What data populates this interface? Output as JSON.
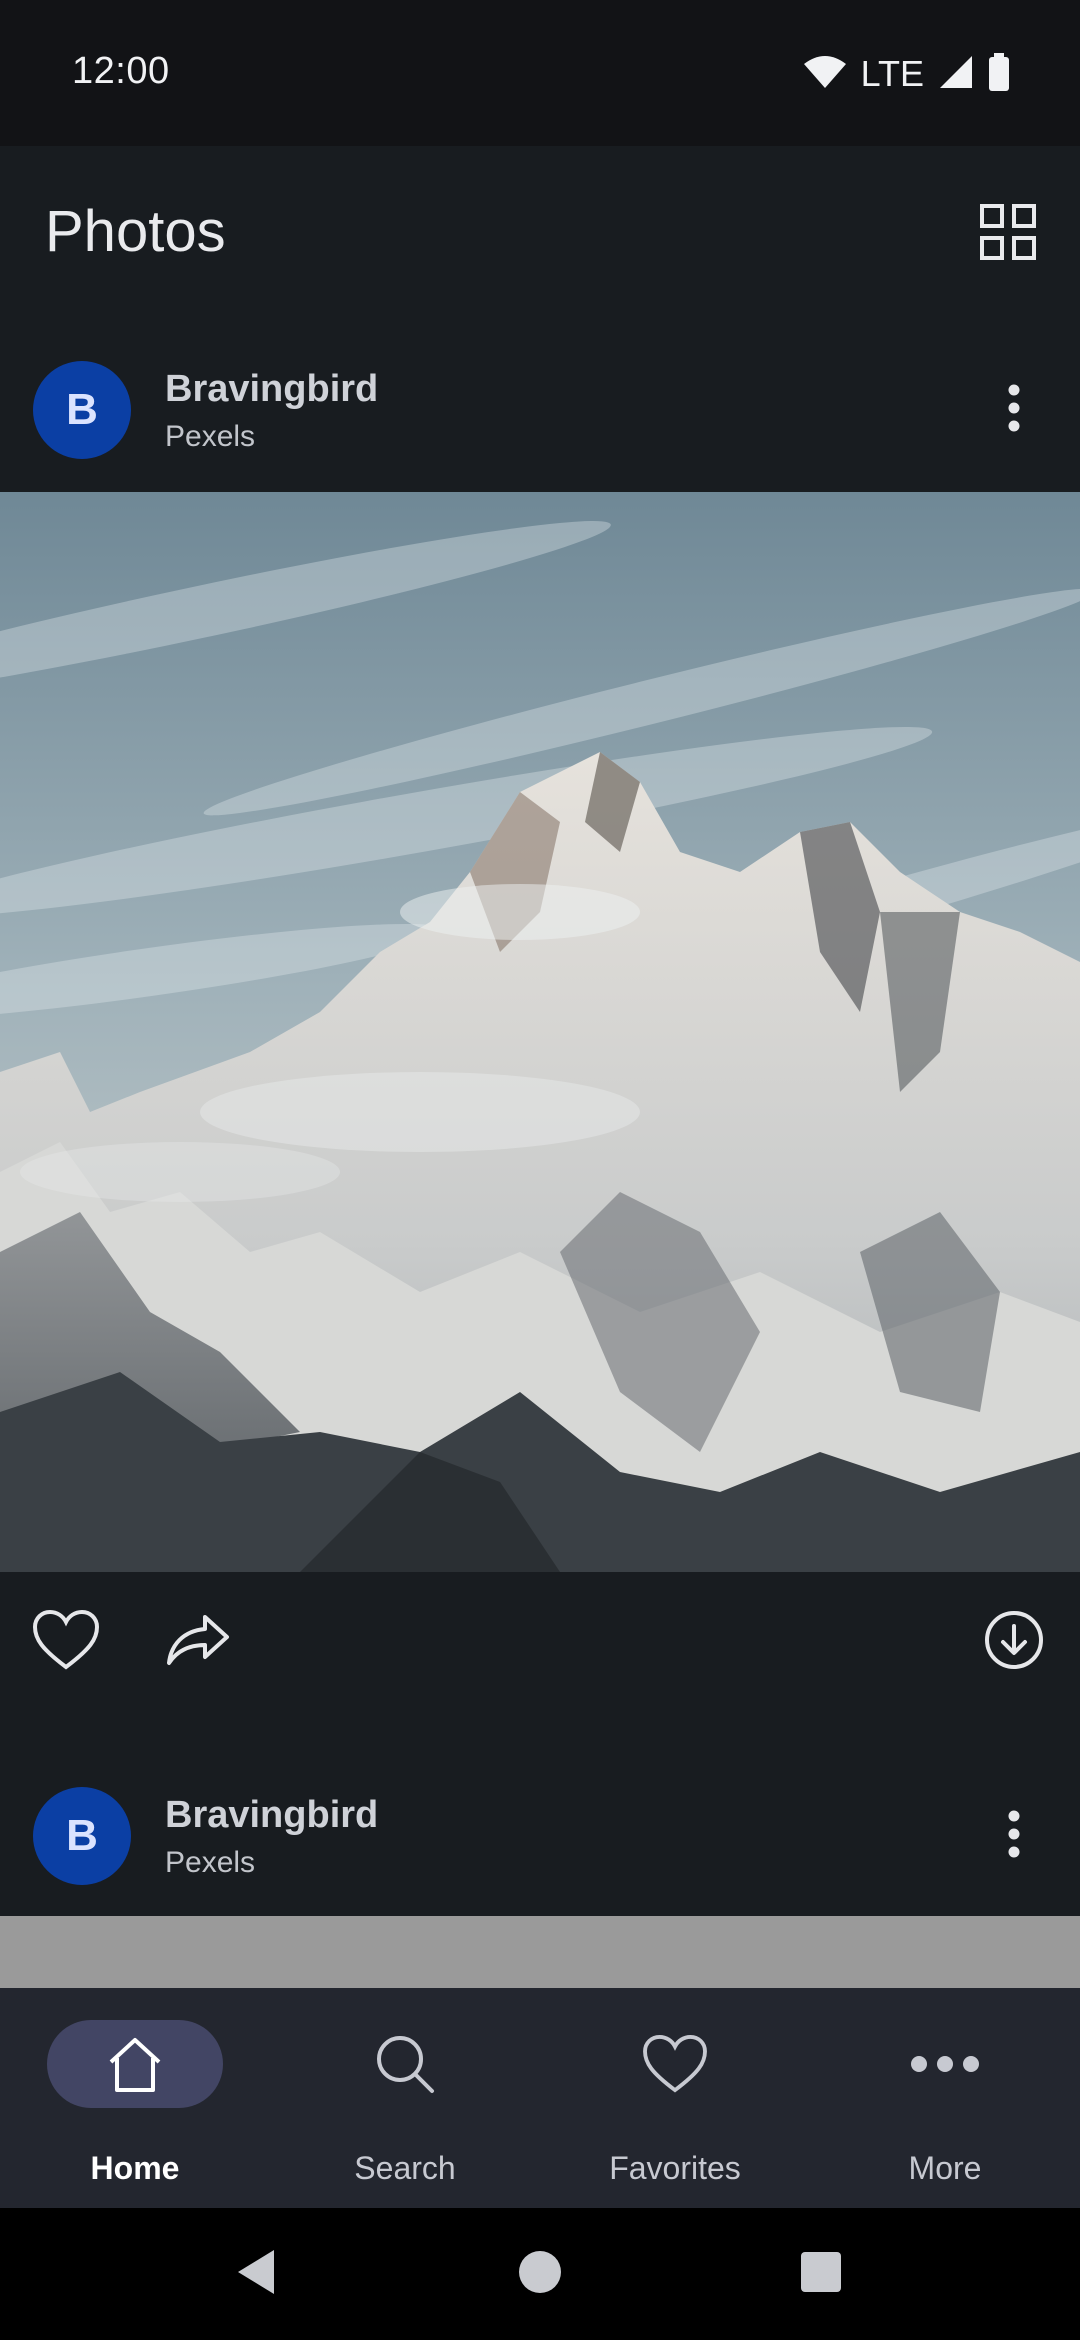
{
  "status_bar": {
    "time": "12:00",
    "network": "LTE",
    "icons": [
      "wifi-icon",
      "signal-icon",
      "battery-icon"
    ]
  },
  "app_bar": {
    "title": "Photos",
    "layout_toggle_icon": "grid-icon"
  },
  "feed": [
    {
      "avatar_initial": "B",
      "author": "Bravingbird",
      "source": "Pexels",
      "image_subject": "snow-covered mountain peaks under cloudy sky",
      "actions": [
        "heart-icon",
        "share-icon",
        "download-icon"
      ]
    },
    {
      "avatar_initial": "B",
      "author": "Bravingbird",
      "source": "Pexels"
    }
  ],
  "bottom_nav": {
    "items": [
      {
        "label": "Home",
        "icon": "home-icon",
        "active": true
      },
      {
        "label": "Search",
        "icon": "search-icon",
        "active": false
      },
      {
        "label": "Favorites",
        "icon": "heart-icon",
        "active": false
      },
      {
        "label": "More",
        "icon": "more-horiz-icon",
        "active": false
      }
    ]
  },
  "colors": {
    "background": "#181c20",
    "status_bar": "#121316",
    "avatar": "#0b3fa4",
    "nav_background": "#23262f",
    "nav_indicator": "#424564"
  }
}
